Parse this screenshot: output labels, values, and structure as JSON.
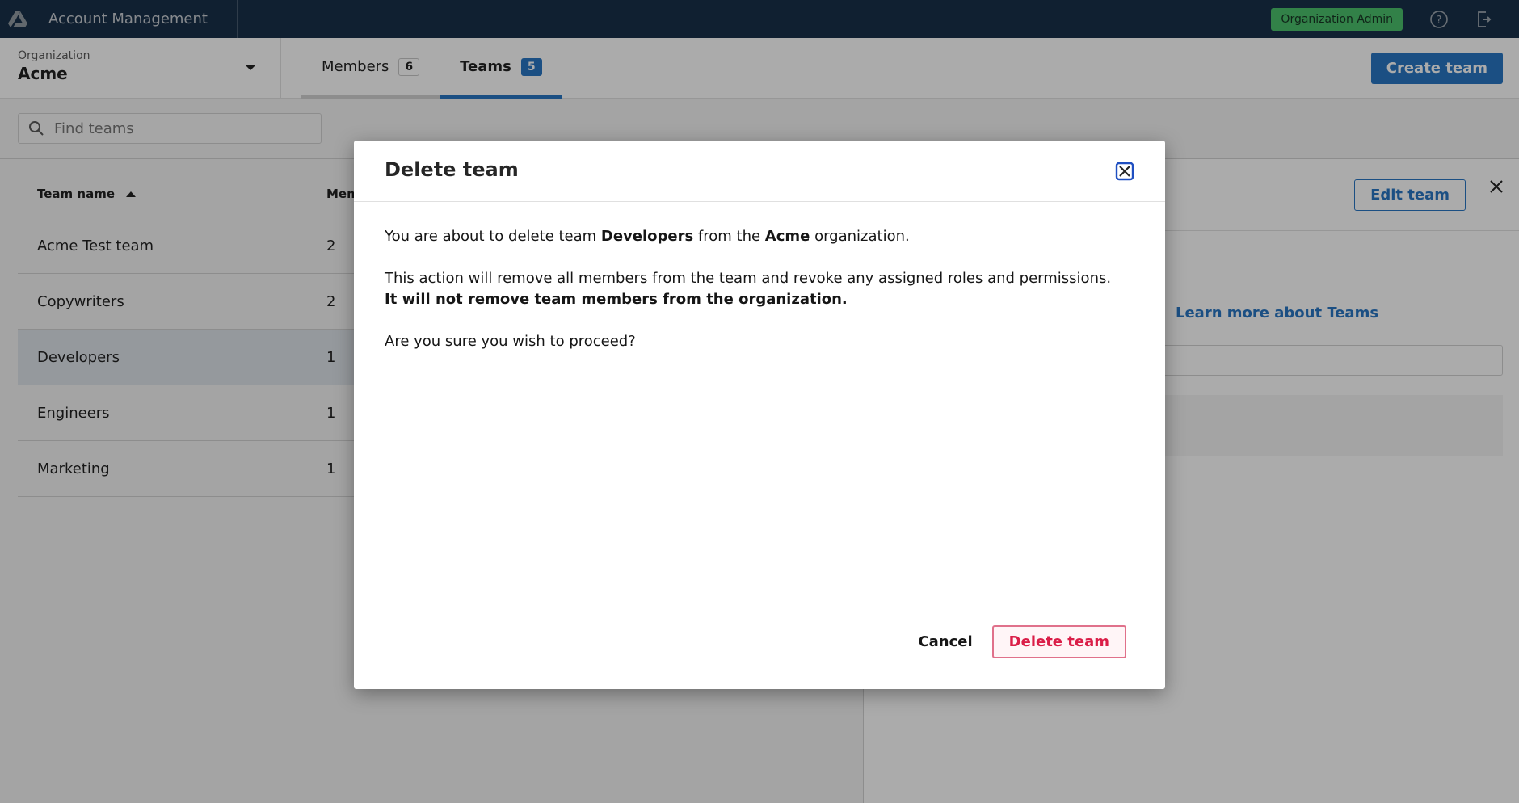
{
  "header": {
    "app_title": "Account Management",
    "role_badge": "Organization Admin",
    "icons": {
      "logo": "product-logo-icon",
      "help": "help-circle-icon",
      "logout": "logout-icon"
    }
  },
  "organization": {
    "label": "Organization",
    "value": "Acme"
  },
  "tabs": [
    {
      "label": "Members",
      "count": "6",
      "active": false
    },
    {
      "label": "Teams",
      "count": "5",
      "active": true
    }
  ],
  "toolbar": {
    "create_team_label": "Create team"
  },
  "search": {
    "placeholder": "Find teams",
    "value": ""
  },
  "table": {
    "columns": [
      "Team name",
      "Mem"
    ],
    "sort": {
      "column": "Team name",
      "direction": "ascending"
    },
    "rows": [
      {
        "name": "Acme Test team",
        "members": "2",
        "selected": false
      },
      {
        "name": "Copywriters",
        "members": "2",
        "selected": false
      },
      {
        "name": "Developers",
        "members": "1",
        "selected": true
      },
      {
        "name": "Engineers",
        "members": "1",
        "selected": false
      },
      {
        "name": "Marketing",
        "members": "1",
        "selected": false
      }
    ]
  },
  "detail_panel": {
    "edit_label": "Edit team",
    "learn_more": "Learn more about Teams"
  },
  "modal": {
    "title": "Delete team",
    "line1_pre": "You are about to delete team ",
    "team_name": "Developers",
    "line1_mid": " from the ",
    "org_name": "Acme",
    "line1_post": " organization.",
    "line2": "This action will remove all members from the team and revoke any assigned roles and permissions.",
    "line3": "It will not remove team members from the organization.",
    "line4": "Are you sure you wish to proceed?",
    "cancel_label": "Cancel",
    "confirm_label": "Delete team"
  },
  "colors": {
    "topbar": "#0e2740",
    "primary": "#1f70c1",
    "danger": "#da1e48",
    "badge": "#42be65"
  }
}
